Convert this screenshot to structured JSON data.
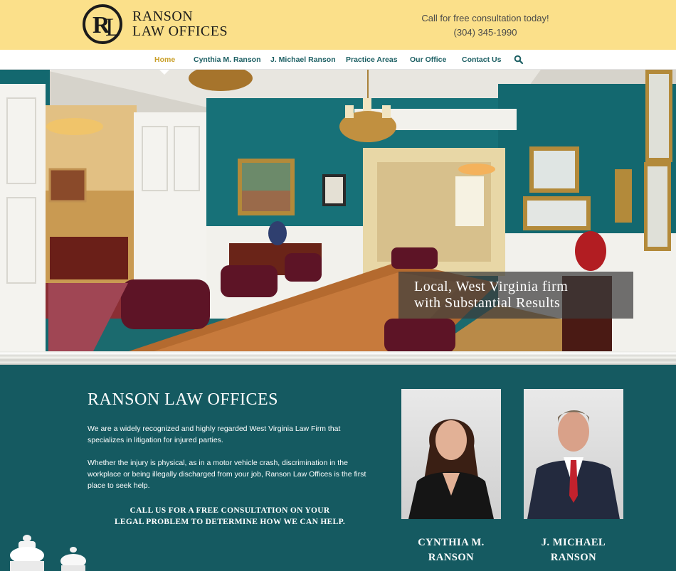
{
  "colors": {
    "header_bg": "#fbe08a",
    "nav_text": "#1c5f63",
    "nav_active": "#caa02a",
    "content_bg": "#155a61",
    "wall_teal": "#177178"
  },
  "logo": {
    "monogram": "RL",
    "line1": "RANSON",
    "line2": "LAW OFFICES"
  },
  "header": {
    "contact_line": "Call for free consultation today!",
    "phone": "(304) 345-1990"
  },
  "nav": {
    "items": [
      {
        "label": "Home",
        "active": true
      },
      {
        "label": "Cynthia M. Ranson",
        "active": false
      },
      {
        "label": "J. Michael Ranson",
        "active": false
      },
      {
        "label": "Practice Areas",
        "active": false
      },
      {
        "label": "Our Office",
        "active": false
      },
      {
        "label": "Contact Us",
        "active": false
      }
    ],
    "search_icon": "search-icon"
  },
  "hero": {
    "caption_line1": "Local, West Virginia firm",
    "caption_line2": "with Substantial Results"
  },
  "main": {
    "title": "RANSON LAW OFFICES",
    "paragraph1": "We are a widely recognized and highly regarded West Virginia Law Firm that specializes in litigation for injured parties.",
    "paragraph2": "Whether the injury is physical, as in a motor vehicle crash, discrimination in the workplace or being illegally discharged from your job, Ranson Law Offices is the first place to seek help.",
    "cta_line1": "CALL US FOR A FREE CONSULTATION ON YOUR",
    "cta_line2": "LEGAL PROBLEM TO DETERMINE HOW WE CAN HELP."
  },
  "attorneys": [
    {
      "name_line1": "CYNTHIA M.",
      "name_line2": "RANSON"
    },
    {
      "name_line1": "J. MICHAEL",
      "name_line2": "RANSON"
    }
  ]
}
